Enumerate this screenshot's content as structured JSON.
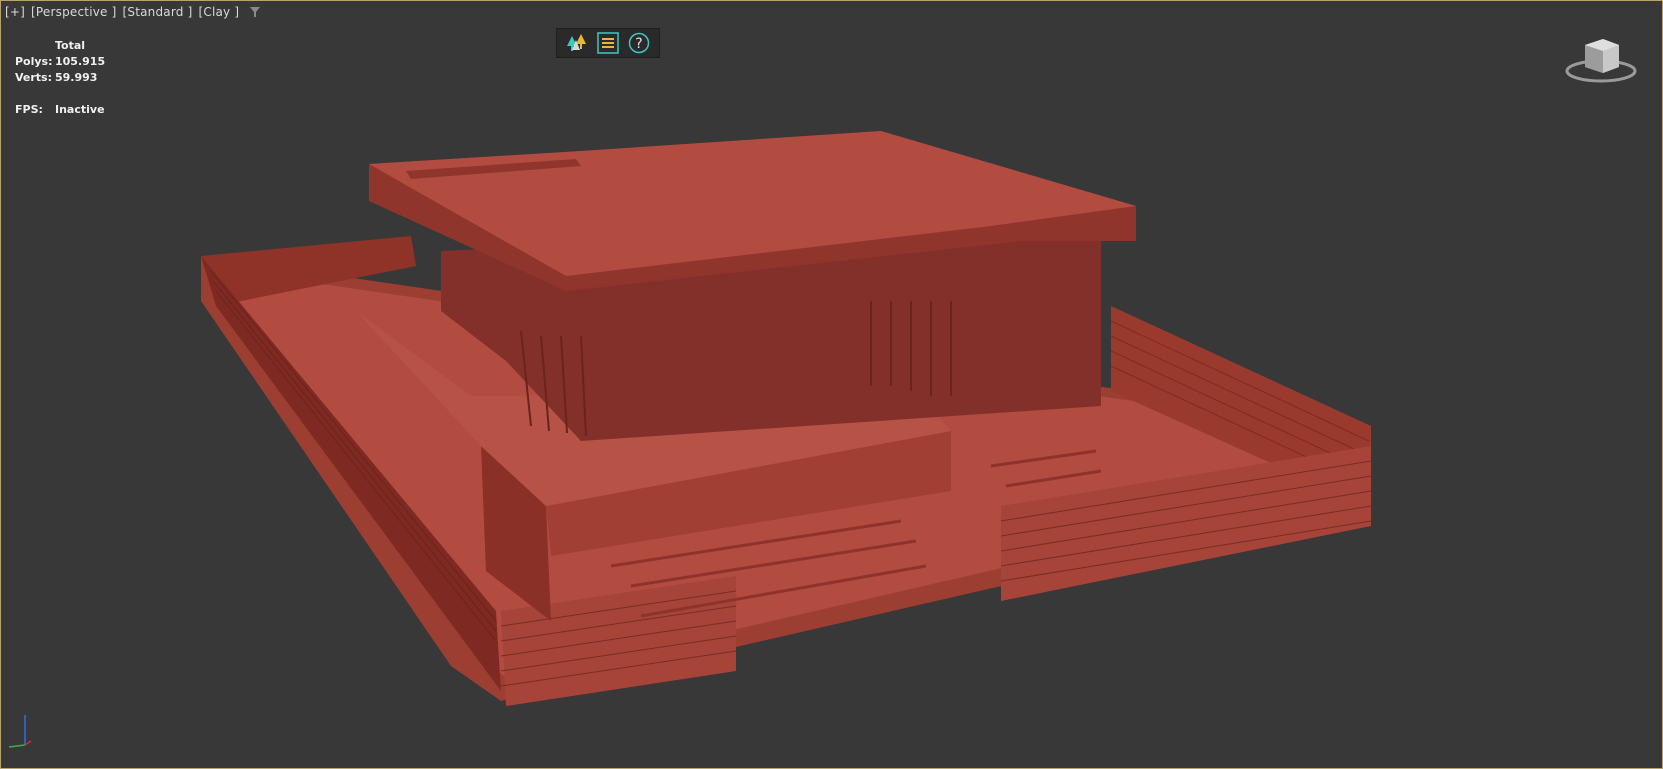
{
  "viewport": {
    "labels": {
      "plus": "[+]",
      "view": "[Perspective ]",
      "shading": "[Standard ]",
      "style": "[Clay ]"
    },
    "filter_icon": "filter-icon"
  },
  "stats": {
    "header": "Total",
    "polys_label": "Polys:",
    "polys_value": "105.915",
    "verts_label": "Verts:",
    "verts_value": "59.993",
    "fps_label": "FPS:",
    "fps_value": "Inactive"
  },
  "toolbar": {
    "buttons": [
      {
        "icon": "trees-icon"
      },
      {
        "icon": "layers-list-icon"
      },
      {
        "icon": "help-icon"
      }
    ]
  },
  "navigation": {
    "viewcube_icon": "viewcube-icon",
    "axis_icon": "axis-tripod-icon"
  },
  "colors": {
    "background": "#383838",
    "clay": "#b24c40",
    "clay_dark": "#7e2a22",
    "border": "#b8a46a"
  }
}
